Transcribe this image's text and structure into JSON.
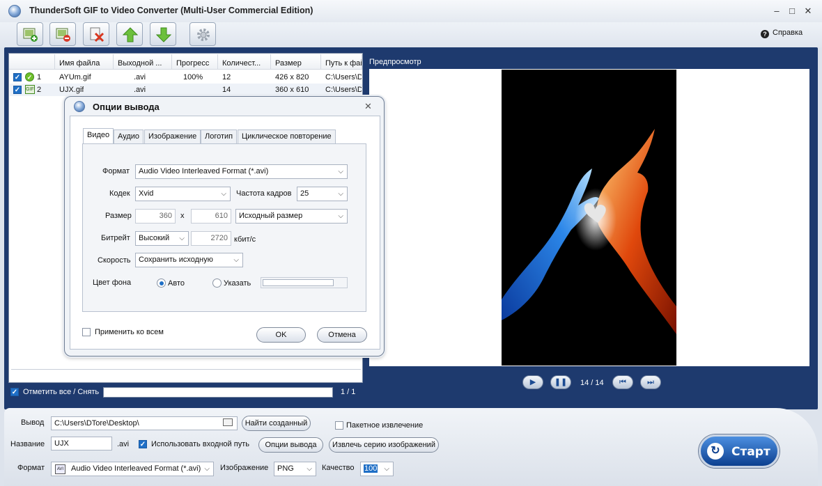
{
  "window": {
    "title": "ThunderSoft GIF to Video Converter (Multi-User Commercial Edition)",
    "controls": [
      "–",
      "□",
      "✕"
    ]
  },
  "toolbar": {
    "help_label": "Справка",
    "help_icon": "?",
    "buttons": [
      "add-file-icon",
      "remove-file-icon",
      "clear-list-icon",
      "move-up-icon",
      "move-down-icon",
      "settings-icon"
    ]
  },
  "file_list": {
    "columns": [
      "Имя файла",
      "Выходной ...",
      "Прогресс",
      "Количест...",
      "Размер",
      "Путь к фай"
    ],
    "rows": [
      {
        "num": "1",
        "name": "AYUm.gif",
        "output": ".avi",
        "progress": "100%",
        "count": "12",
        "size": "426 x 820",
        "path": "C:\\Users\\D"
      },
      {
        "num": "2",
        "name": "UJX.gif",
        "output": ".avi",
        "progress": "",
        "count": "14",
        "size": "360 x 610",
        "path": "C:\\Users\\D"
      }
    ],
    "select_all_label": "Отметить все / Снять",
    "page_count": "1 / 1"
  },
  "preview": {
    "label": "Предпросмотр",
    "frame_counter": "14 / 14",
    "play_icon": "▶",
    "pause_icon": "❚❚",
    "prev_icon": "⏮",
    "next_icon": "⏭"
  },
  "dialog": {
    "title": "Опции вывода",
    "close": "✕",
    "tabs": [
      "Видео",
      "Аудио",
      "Изображение",
      "Логотип",
      "Циклическое повторение"
    ],
    "format_label": "Формат",
    "format_value": "Audio Video Interleaved Format (*.avi)",
    "codec_label": "Кодек",
    "codec_value": "Xvid",
    "framerate_label": "Частота кадров",
    "framerate_value": "25",
    "size_label": "Размер",
    "width": "360",
    "x": "x",
    "height": "610",
    "size_mode": "Исходный размер",
    "bitrate_label": "Битрейт",
    "bitrate_mode": "Высокий",
    "bitrate_value": "2720",
    "bitrate_unit": "кбит/с",
    "speed_label": "Скорость",
    "speed_value": "Сохранить исходную",
    "bg_label": "Цвет фона",
    "bg_auto": "Авто",
    "bg_custom": "Указать",
    "apply_all": "Применить ко всем",
    "ok": "OK",
    "cancel": "Отмена",
    "dropdown_arrow": "⌵"
  },
  "bottom": {
    "output_label": "Вывод",
    "output_path": "C:\\Users\\DTore\\Desktop\\",
    "find_created": "Найти созданный",
    "batch_extract": "Пакетное извлечение",
    "name_label": "Название",
    "name_value": "UJX",
    "name_ext": ".avi",
    "use_input_path": "Использовать входной путь",
    "output_options": "Опции вывода",
    "extract_images": "Извлечь серию изображений",
    "format_label": "Формат",
    "format_value": "Audio Video Interleaved Format (*.avi)",
    "image_label": "Изображение",
    "image_value": "PNG",
    "quality_label": "Качество",
    "quality_value": "100",
    "start_label": "Старт",
    "dropdown_arrow": "⌵"
  }
}
